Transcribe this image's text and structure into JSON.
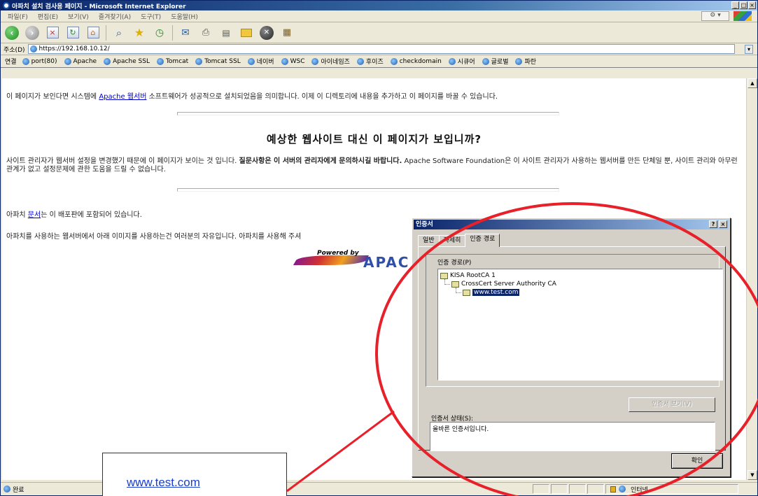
{
  "window": {
    "title": "아파치 설치 검사용 페이지 - Microsoft Internet Explorer"
  },
  "menubar": {
    "items": [
      "파일(F)",
      "편집(E)",
      "보기(V)",
      "즐겨찾기(A)",
      "도구(T)",
      "도움말(H)"
    ]
  },
  "address": {
    "label": "주소(D)",
    "url": "https://192.168.10.12/"
  },
  "links": {
    "label": "연결",
    "items": [
      "port(80)",
      "Apache",
      "Apache SSL",
      "Tomcat",
      "Tomcat SSL",
      "네이버",
      "WSC",
      "아이네임즈",
      "후이즈",
      "checkdomain",
      "시큐어",
      "글로벌",
      "파란"
    ]
  },
  "page": {
    "p1_before": "이 페이지가 보인다면 시스템에 ",
    "p1_link": "Apache 웹서버",
    "p1_after": " 소프트웨어가 성공적으로 설치되었음을 의미합니다. 이제 이 디렉토리에 내용을 추가하고 이 페이지를 바꿀 수 있습니다.",
    "heading": "예상한 웹사이트 대신 이 페이지가 보입니까?",
    "p2_a": "사이트 관리자가 웹서버 설정을 변경했기 때문에 이 페이지가 보이는 것 입니다. ",
    "p2_bold": "질문사항은 이 서버의 관리자에게 문의하시길 바랍니다.",
    "p2_b": " Apache Software Foundation은 이 사이트 관리자가 사용하는 웹서버를 만든 단체일 뿐, 사이트 관리와 아무런 관계가 없고 설정문제에 관한 도움을 드릴 수 없습니다.",
    "p3_before": "아파치 ",
    "p3_link": "문서",
    "p3_after": "는 이 배포판에 포함되어 있습니다.",
    "p4": "아파치를 사용하는 웹서버에서 아래 이미지를 사용하는건 여러분의 자유입니다. 아파치를 사용해 주셔",
    "powered_by": "Powered by",
    "apache_word": "APAC"
  },
  "status": {
    "text": "완료",
    "zone": "인터넷"
  },
  "dialog": {
    "title": "인증서",
    "help": "?",
    "close": "×",
    "tabs": [
      "일반",
      "자세히",
      "인증 경로"
    ],
    "path_label": "인증 경로(P)",
    "tree": [
      "KISA RootCA 1",
      "CrossCert Server Authority CA",
      "www.test.com"
    ],
    "view_button": "인증서 보기(V)",
    "status_label": "인증서 상태(S):",
    "status_text": "올바른 인증서입니다.",
    "ok_button": "확인"
  },
  "callout": {
    "text": "www.test.com"
  },
  "colors": {
    "highlight_circle": "#e8202a",
    "title_blue": "#0a246a",
    "callout_link": "#1a3fcf"
  }
}
